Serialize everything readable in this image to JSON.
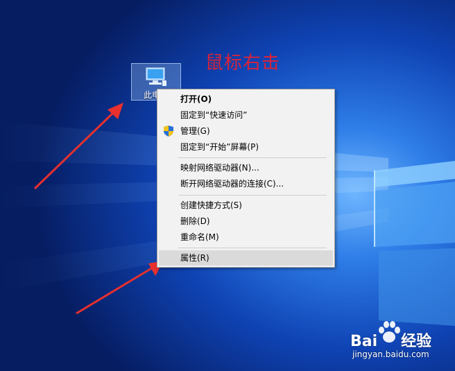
{
  "desktop_icon": {
    "label": "此电脑"
  },
  "annotation": "鼠标右击",
  "menu": {
    "items": [
      {
        "label": "打开(O)"
      },
      {
        "label": "固定到“快速访问”"
      },
      {
        "label": "管理(G)"
      },
      {
        "label": "固定到“开始”屏幕(P)"
      },
      {
        "label": "映射网络驱动器(N)..."
      },
      {
        "label": "断开网络驱动器的连接(C)..."
      },
      {
        "label": "创建快捷方式(S)"
      },
      {
        "label": "删除(D)"
      },
      {
        "label": "重命名(M)"
      },
      {
        "label": "属性(R)"
      }
    ]
  },
  "watermark": {
    "brand": "Bai",
    "brand_suffix": "经验",
    "url": "jingyan.baidu.com"
  },
  "colors": {
    "wallpaper": "#0a2f8c",
    "annotation": "#d8233a",
    "arrow": "#e8302e",
    "menu_bg": "#f2f2f2",
    "menu_highlight": "#dadada"
  },
  "icons": {
    "desktop": "computer-icon",
    "manage": "uac-shield-icon",
    "watermark": "paw-icon"
  }
}
